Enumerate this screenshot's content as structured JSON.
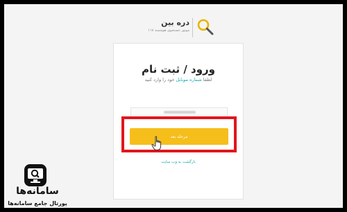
{
  "brand": {
    "name": "دره بین",
    "tagline": "موتور جستجوی هوشمند ۱۱۸",
    "icon": "magnifier-icon"
  },
  "login": {
    "title": "ورود / ثبت نام",
    "subtitle_prefix": "لطفا",
    "subtitle_highlight": "شماره موبایل",
    "subtitle_suffix": "خود را وارد کنید",
    "phone_placeholder": "",
    "next_button": "مرحله بعد",
    "back_link": "بازگشت به وب سایت"
  },
  "watermark": {
    "name": "سامانه‌ها",
    "tagline": "پورتال جامع سامانه‌ها",
    "icon": "monitor-search-icon"
  },
  "colors": {
    "accent": "#f6be1a",
    "link": "#1aa6a6",
    "highlight_border": "#e0161c"
  }
}
